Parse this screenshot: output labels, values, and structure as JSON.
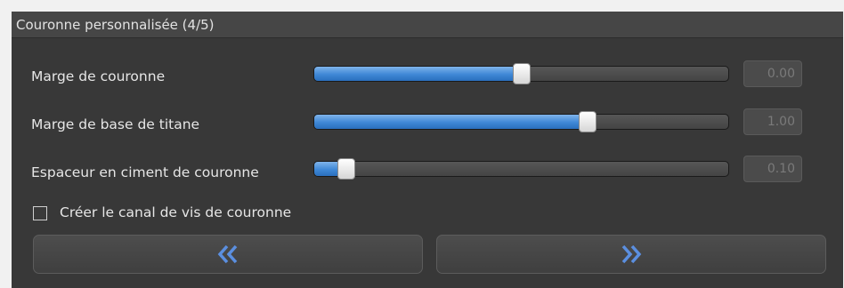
{
  "panel": {
    "title": "Couronne personnalisée (4/5)"
  },
  "sliders": [
    {
      "label": "Marge de couronne",
      "value_text": "0.00",
      "position": 0.5
    },
    {
      "label": "Marge de base de titane",
      "value_text": "1.00",
      "position": 0.66
    },
    {
      "label": "Espaceur en ciment de couronne",
      "value_text": "0.10",
      "position": 0.08
    }
  ],
  "checkbox": {
    "label": "Créer le canal de vis de couronne",
    "checked": false
  },
  "nav": {
    "back_icon": "double-chevron-left-icon",
    "next_icon": "double-chevron-right-icon",
    "icon_color": "#5b8fe0"
  },
  "colors": {
    "slider_fill": "#3f88d6",
    "panel_bg": "#383838"
  }
}
